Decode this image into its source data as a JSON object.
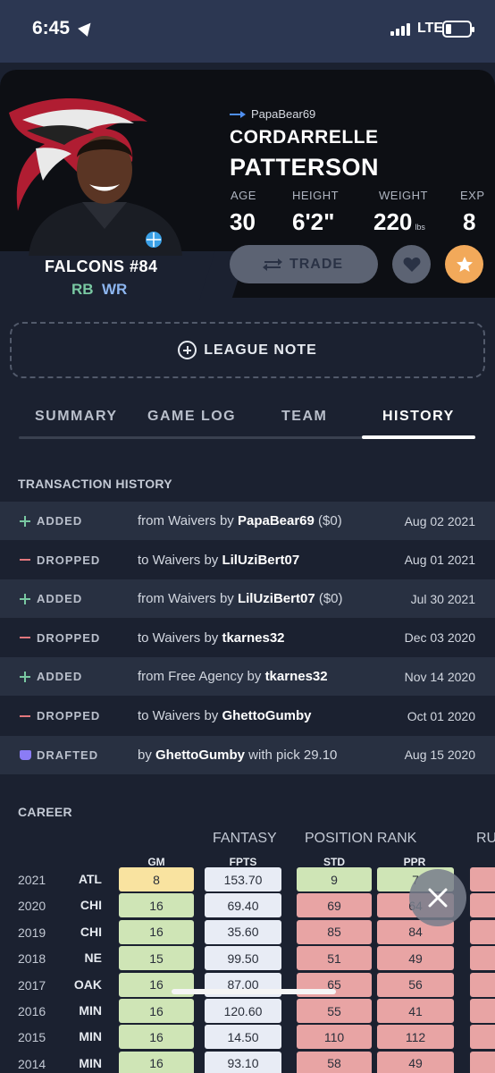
{
  "status_bar": {
    "time": "6:45",
    "network": "LTE"
  },
  "player": {
    "owner": "PapaBear69",
    "first_name": "CORDARRELLE",
    "last_name": "PATTERSON",
    "team_line": "FALCONS  #84",
    "positions": [
      "RB",
      "WR"
    ],
    "stats": [
      {
        "label": "AGE",
        "value": "30",
        "unit": ""
      },
      {
        "label": "HEIGHT",
        "value": "6'2\"",
        "unit": ""
      },
      {
        "label": "WEIGHT",
        "value": "220",
        "unit": "lbs"
      },
      {
        "label": "EXP",
        "value": "8",
        "unit": ""
      }
    ],
    "trade_label": "TRADE",
    "colors": {
      "accent": "#4f8ff0",
      "star": "#f2a95a",
      "falcons_red": "#b01d32"
    }
  },
  "league_note_label": "LEAGUE NOTE",
  "tabs": [
    {
      "label": "SUMMARY",
      "active": false
    },
    {
      "label": "GAME LOG",
      "active": false
    },
    {
      "label": "TEAM",
      "active": false
    },
    {
      "label": "HISTORY",
      "active": true
    }
  ],
  "transactions": {
    "title": "TRANSACTION HISTORY",
    "rows": [
      {
        "icon": "plus-icon",
        "type": "ADDED",
        "prefix": "from Waivers by ",
        "user": "PapaBear69",
        "suffix": " ($0)",
        "date": "Aug 02 2021"
      },
      {
        "icon": "minus-icon",
        "type": "DROPPED",
        "prefix": "to Waivers by ",
        "user": "LilUziBert07",
        "suffix": "",
        "date": "Aug 01 2021"
      },
      {
        "icon": "plus-icon",
        "type": "ADDED",
        "prefix": "from Waivers by ",
        "user": "LilUziBert07",
        "suffix": " ($0)",
        "date": "Jul 30 2021"
      },
      {
        "icon": "minus-icon",
        "type": "DROPPED",
        "prefix": "to Waivers by ",
        "user": "tkarnes32",
        "suffix": "",
        "date": "Dec 03 2020"
      },
      {
        "icon": "plus-icon",
        "type": "ADDED",
        "prefix": "from Free Agency by ",
        "user": "tkarnes32",
        "suffix": "",
        "date": "Nov 14 2020"
      },
      {
        "icon": "minus-icon",
        "type": "DROPPED",
        "prefix": "to Waivers by ",
        "user": "GhettoGumby",
        "suffix": "",
        "date": "Oct 01 2020"
      },
      {
        "icon": "draft-icon",
        "type": "DRAFTED",
        "prefix": "by ",
        "user": "GhettoGumby",
        "suffix": " with pick 29.10",
        "date": "Aug 15 2020"
      }
    ]
  },
  "career": {
    "title": "CAREER",
    "groups": [
      "FANTASY",
      "POSITION RANK",
      "RU"
    ],
    "columns": [
      "GM",
      "FPTS",
      "STD",
      "PPR"
    ],
    "rows": [
      {
        "year": "2021",
        "team": "ATL",
        "gm": "8",
        "fpts": "153.70",
        "std": "9",
        "ppr": "7"
      },
      {
        "year": "2020",
        "team": "CHI",
        "gm": "16",
        "fpts": "69.40",
        "std": "69",
        "ppr": "64"
      },
      {
        "year": "2019",
        "team": "CHI",
        "gm": "16",
        "fpts": "35.60",
        "std": "85",
        "ppr": "84"
      },
      {
        "year": "2018",
        "team": "NE",
        "gm": "15",
        "fpts": "99.50",
        "std": "51",
        "ppr": "49"
      },
      {
        "year": "2017",
        "team": "OAK",
        "gm": "16",
        "fpts": "87.00",
        "std": "65",
        "ppr": "56"
      },
      {
        "year": "2016",
        "team": "MIN",
        "gm": "16",
        "fpts": "120.60",
        "std": "55",
        "ppr": "41"
      },
      {
        "year": "2015",
        "team": "MIN",
        "gm": "16",
        "fpts": "14.50",
        "std": "110",
        "ppr": "112"
      },
      {
        "year": "2014",
        "team": "MIN",
        "gm": "16",
        "fpts": "93.10",
        "std": "58",
        "ppr": "49"
      }
    ]
  }
}
